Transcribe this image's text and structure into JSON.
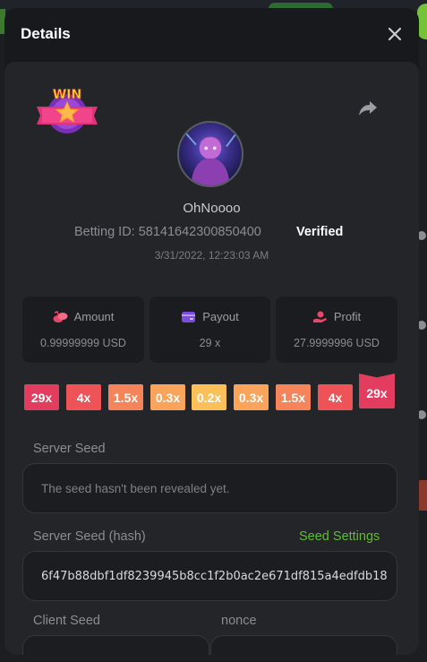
{
  "modal": {
    "title": "Details"
  },
  "player": {
    "username": "OhNoooo",
    "betting_id_label": "Betting ID: 58141642300850400",
    "verified_label": "Verified",
    "timestamp": "3/31/2022, 12:23:03 AM"
  },
  "stats": [
    {
      "label": "Amount",
      "value": "0.99999999 USD",
      "icon": "coins-icon",
      "color": "#e8476a"
    },
    {
      "label": "Payout",
      "value": "29 x",
      "icon": "wallet-icon",
      "color": "#7a4de0"
    },
    {
      "label": "Profit",
      "value": "27.9999996 USD",
      "icon": "profit-hand-icon",
      "color": "#e8476a"
    }
  ],
  "multipliers": [
    {
      "label": "29x",
      "color": "#e23c5e"
    },
    {
      "label": "4x",
      "color": "#ee5358"
    },
    {
      "label": "1.5x",
      "color": "#f6845a"
    },
    {
      "label": "0.3x",
      "color": "#f9a45a"
    },
    {
      "label": "0.2x",
      "color": "#fcc05a"
    },
    {
      "label": "0.3x",
      "color": "#f9a45a"
    },
    {
      "label": "1.5x",
      "color": "#f6845a"
    },
    {
      "label": "4x",
      "color": "#ee5358"
    },
    {
      "label": "29x",
      "color": "#e23c5e"
    }
  ],
  "seeds": {
    "server_seed_label": "Server Seed",
    "server_seed_value": "The seed hasn't been revealed yet.",
    "server_seed_hash_label": "Server Seed (hash)",
    "seed_settings_link": "Seed Settings",
    "server_seed_hash_value": "6f47b88dbf1df8239945b8cc1f2b0ac2e671df815a4edfdb18",
    "client_seed_label": "Client Seed",
    "nonce_label": "nonce"
  },
  "badge": {
    "text": "WIN"
  }
}
